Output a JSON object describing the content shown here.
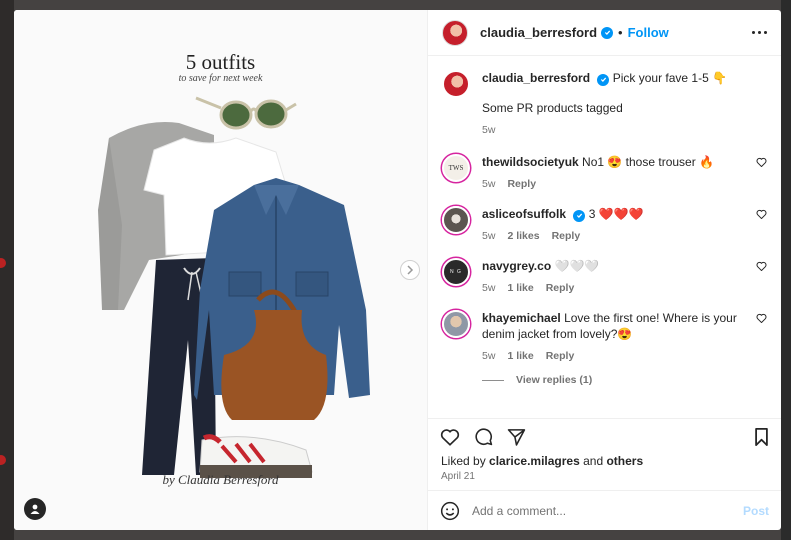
{
  "post": {
    "title": "5 outfits",
    "subtitle": "to save for next week",
    "signature": "by Claudia Berresford"
  },
  "header": {
    "username": "claudia_berresford",
    "separator": "•",
    "follow_label": "Follow",
    "more_icon": "more-horizontal-icon"
  },
  "caption": {
    "username": "claudia_berresford",
    "text": "Pick your fave 1-5 👇",
    "tagged": "Some PR products tagged",
    "age": "5w"
  },
  "comments": [
    {
      "username": "thewildsocietyuk",
      "text": "No1 😍 those trouser 🔥",
      "age": "5w",
      "likes": "",
      "reply": "Reply",
      "avatar_color": "#f3efe8"
    },
    {
      "username": "asliceofsuffolk",
      "text": "3 ❤️❤️❤️",
      "age": "5w",
      "likes": "2 likes",
      "reply": "Reply",
      "avatar_color": "#5b5550",
      "verified": true
    },
    {
      "username": "navygrey.co",
      "text": "🤍🤍🤍",
      "age": "5w",
      "likes": "1 like",
      "reply": "Reply",
      "avatar_color": "#2a2a2a"
    },
    {
      "username": "khayemichael",
      "text": "Love the first one! Where is your denim jacket from lovely?😍",
      "age": "5w",
      "likes": "1 like",
      "reply": "Reply",
      "avatar_color": "#c9b7a2"
    }
  ],
  "view_replies": "View replies (1)",
  "likes_line": {
    "prefix": "Liked by ",
    "user": "clarice.milagres",
    "middle": " and ",
    "others": "others"
  },
  "date": "April 21",
  "add_comment": {
    "placeholder": "Add a comment...",
    "post_label": "Post"
  },
  "colors": {
    "accent": "#0095f6",
    "post_disabled": "#b3dbff",
    "muted": "#737373"
  }
}
